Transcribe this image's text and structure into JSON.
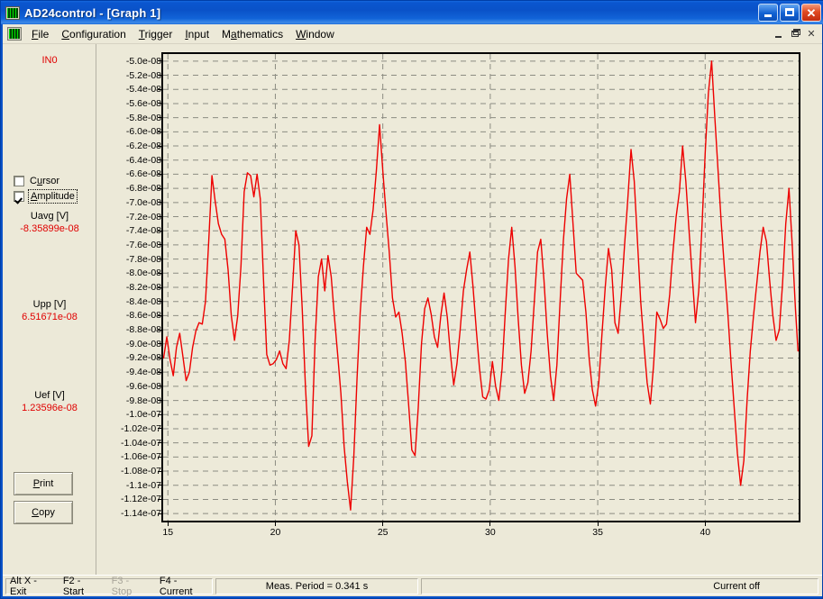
{
  "window": {
    "title": "AD24control - [Graph 1]",
    "icon": "oscilloscope-icon",
    "buttons": {
      "minimize": "_",
      "maximize": "□",
      "close": "✕"
    }
  },
  "menu": {
    "icon": "oscilloscope-icon",
    "items": [
      {
        "label": "File",
        "accel": "F"
      },
      {
        "label": "Configuration",
        "accel": "C"
      },
      {
        "label": "Trigger",
        "accel": "T"
      },
      {
        "label": "Input",
        "accel": "I"
      },
      {
        "label": "Mathematics",
        "accel": "a"
      },
      {
        "label": "Window",
        "accel": "W"
      }
    ],
    "mdi_buttons": {
      "minimize": "_",
      "restore": "❐",
      "close": "✕"
    }
  },
  "side_panel": {
    "channel": "IN0",
    "checkboxes": [
      {
        "name": "cursor",
        "label": "Cursor",
        "checked": false,
        "focused": false
      },
      {
        "name": "amplitude",
        "label": "Amplitude",
        "checked": true,
        "focused": true
      }
    ],
    "measurements": [
      {
        "name": "Uavg [V]",
        "value": "-8.35899e-08"
      },
      {
        "name": "Upp [V]",
        "value": "6.51671e-08"
      },
      {
        "name": "Uef [V]",
        "value": "1.23596e-08"
      }
    ],
    "buttons": [
      {
        "name": "print",
        "label": "Print"
      },
      {
        "name": "copy",
        "label": "Copy"
      }
    ]
  },
  "status_bar": {
    "keys": [
      {
        "label": "Alt X - Exit",
        "enabled": true
      },
      {
        "label": "F2 - Start",
        "enabled": true
      },
      {
        "label": "F3 - Stop",
        "enabled": false
      },
      {
        "label": "F4 - Current",
        "enabled": true
      }
    ],
    "period": "Meas. Period = 0.341 s",
    "current": "Current off"
  },
  "colors": {
    "trace": "#ee0000",
    "plot_background": "#edead9",
    "grid": "#8c8c82",
    "panel": "#ece9d8",
    "accent_text": "#e00000",
    "titlebar": "#0a52c8"
  },
  "chart_data": {
    "type": "line",
    "title": "Graph 1",
    "xlabel": "",
    "ylabel": "",
    "xlim": [
      14.78,
      44.35
    ],
    "ylim": [
      -1.15e-07,
      -4.9e-08
    ],
    "grid": true,
    "legend": false,
    "series_name": "IN0",
    "xticks": [
      15,
      20,
      25,
      30,
      35,
      40
    ],
    "yticks": [
      "-5.0e-08",
      "-5.2e-08",
      "-5.4e-08",
      "-5.6e-08",
      "-5.8e-08",
      "-6.0e-08",
      "-6.2e-08",
      "-6.4e-08",
      "-6.6e-08",
      "-6.8e-08",
      "-7.0e-08",
      "-7.2e-08",
      "-7.4e-08",
      "-7.6e-08",
      "-7.8e-08",
      "-8.0e-08",
      "-8.2e-08",
      "-8.4e-08",
      "-8.6e-08",
      "-8.8e-08",
      "-9.0e-08",
      "-9.2e-08",
      "-9.4e-08",
      "-9.6e-08",
      "-9.8e-08",
      "-1.0e-07",
      "-1.02e-07",
      "-1.04e-07",
      "-1.06e-07",
      "-1.08e-07",
      "-1.1e-07",
      "-1.12e-07",
      "-1.14e-07"
    ],
    "ytick_values": [
      -5e-08,
      -5.2e-08,
      -5.4e-08,
      -5.6e-08,
      -5.8e-08,
      -6e-08,
      -6.2e-08,
      -6.4e-08,
      -6.6e-08,
      -6.8e-08,
      -7e-08,
      -7.2e-08,
      -7.4e-08,
      -7.6e-08,
      -7.8e-08,
      -8e-08,
      -8.2e-08,
      -8.4e-08,
      -8.6e-08,
      -8.8e-08,
      -9e-08,
      -9.2e-08,
      -9.4e-08,
      -9.6e-08,
      -9.8e-08,
      -1e-07,
      -1.02e-07,
      -1.04e-07,
      -1.06e-07,
      -1.08e-07,
      -1.1e-07,
      -1.12e-07,
      -1.14e-07
    ],
    "x": [
      14.8,
      14.95,
      15.1,
      15.25,
      15.4,
      15.55,
      15.7,
      15.85,
      16.0,
      16.15,
      16.3,
      16.45,
      16.6,
      16.75,
      16.9,
      17.05,
      17.2,
      17.35,
      17.5,
      17.65,
      17.8,
      17.95,
      18.1,
      18.25,
      18.4,
      18.55,
      18.7,
      18.85,
      19.0,
      19.15,
      19.3,
      19.45,
      19.6,
      19.75,
      19.9,
      20.05,
      20.2,
      20.35,
      20.5,
      20.65,
      20.8,
      20.95,
      21.1,
      21.25,
      21.4,
      21.55,
      21.7,
      21.85,
      22.0,
      22.15,
      22.3,
      22.45,
      22.6,
      22.75,
      22.9,
      23.05,
      23.2,
      23.35,
      23.5,
      23.65,
      23.8,
      23.95,
      24.1,
      24.25,
      24.4,
      24.55,
      24.7,
      24.85,
      25.0,
      25.15,
      25.3,
      25.45,
      25.6,
      25.75,
      25.9,
      26.05,
      26.2,
      26.35,
      26.5,
      26.65,
      26.8,
      26.95,
      27.1,
      27.25,
      27.4,
      27.55,
      27.7,
      27.85,
      28.0,
      28.15,
      28.3,
      28.45,
      28.6,
      28.75,
      28.9,
      29.05,
      29.2,
      29.35,
      29.5,
      29.65,
      29.8,
      29.95,
      30.1,
      30.25,
      30.4,
      30.55,
      30.7,
      30.85,
      31.0,
      31.15,
      31.3,
      31.45,
      31.6,
      31.75,
      31.9,
      32.05,
      32.2,
      32.35,
      32.5,
      32.65,
      32.8,
      32.95,
      33.1,
      33.25,
      33.4,
      33.55,
      33.7,
      33.85,
      34.0,
      34.15,
      34.3,
      34.45,
      34.6,
      34.75,
      34.9,
      35.05,
      35.2,
      35.35,
      35.5,
      35.65,
      35.8,
      35.95,
      36.1,
      36.25,
      36.4,
      36.55,
      36.7,
      36.85,
      37.0,
      37.15,
      37.3,
      37.45,
      37.6,
      37.75,
      37.9,
      38.05,
      38.2,
      38.35,
      38.5,
      38.65,
      38.8,
      38.95,
      39.1,
      39.25,
      39.4,
      39.55,
      39.7,
      39.85,
      40.0,
      40.15,
      40.3,
      40.45,
      40.6,
      40.75,
      40.9,
      41.05,
      41.2,
      41.35,
      41.5,
      41.65,
      41.8,
      41.95,
      42.1,
      42.25,
      42.4,
      42.55,
      42.7,
      42.85,
      43.0,
      43.15,
      43.3,
      43.45,
      43.6,
      43.75,
      43.9,
      44.05,
      44.2,
      44.32
    ],
    "y": [
      -9.2e-08,
      -8.9e-08,
      -9.22e-08,
      -9.45e-08,
      -9.05e-08,
      -8.85e-08,
      -9.18e-08,
      -9.52e-08,
      -9.4e-08,
      -9.05e-08,
      -8.82e-08,
      -8.7e-08,
      -8.72e-08,
      -8.4e-08,
      -7.55e-08,
      -6.62e-08,
      -6.98e-08,
      -7.3e-08,
      -7.45e-08,
      -7.52e-08,
      -7.95e-08,
      -8.6e-08,
      -8.95e-08,
      -8.6e-08,
      -7.9e-08,
      -6.85e-08,
      -6.58e-08,
      -6.62e-08,
      -6.92e-08,
      -6.6e-08,
      -6.95e-08,
      -8.1e-08,
      -9.15e-08,
      -9.3e-08,
      -9.28e-08,
      -9.22e-08,
      -9.1e-08,
      -9.28e-08,
      -9.35e-08,
      -8.95e-08,
      -8.2e-08,
      -7.4e-08,
      -7.6e-08,
      -8.5e-08,
      -9.6e-08,
      -1.045e-07,
      -1.03e-07,
      -8.95e-08,
      -8.05e-08,
      -7.8e-08,
      -8.25e-08,
      -7.75e-08,
      -8.05e-08,
      -8.62e-08,
      -9.15e-08,
      -9.7e-08,
      -1.045e-07,
      -1.095e-07,
      -1.135e-07,
      -1.06e-07,
      -9.5e-08,
      -8.55e-08,
      -7.9e-08,
      -7.35e-08,
      -7.45e-08,
      -7.1e-08,
      -6.55e-08,
      -5.9e-08,
      -6.55e-08,
      -7.15e-08,
      -7.7e-08,
      -8.35e-08,
      -8.62e-08,
      -8.55e-08,
      -8.85e-08,
      -9.25e-08,
      -9.85e-08,
      -1.05e-07,
      -1.058e-07,
      -9.9e-08,
      -9e-08,
      -8.5e-08,
      -8.35e-08,
      -8.58e-08,
      -8.9e-08,
      -9.05e-08,
      -8.6e-08,
      -8.28e-08,
      -8.62e-08,
      -9.15e-08,
      -9.58e-08,
      -9.28e-08,
      -8.8e-08,
      -8.25e-08,
      -7.95e-08,
      -7.7e-08,
      -8.2e-08,
      -8.8e-08,
      -9.35e-08,
      -9.75e-08,
      -9.78e-08,
      -9.65e-08,
      -9.25e-08,
      -9.6e-08,
      -9.8e-08,
      -9.35e-08,
      -8.55e-08,
      -7.8e-08,
      -7.35e-08,
      -7.9e-08,
      -8.65e-08,
      -9.3e-08,
      -9.7e-08,
      -9.55e-08,
      -9.1e-08,
      -8.4e-08,
      -7.7e-08,
      -7.52e-08,
      -8.1e-08,
      -8.85e-08,
      -9.45e-08,
      -9.8e-08,
      -9.3e-08,
      -8.4e-08,
      -7.55e-08,
      -6.95e-08,
      -6.6e-08,
      -7.3e-08,
      -8e-08,
      -8.05e-08,
      -8.1e-08,
      -8.55e-08,
      -9.2e-08,
      -9.65e-08,
      -9.88e-08,
      -9.55e-08,
      -8.85e-08,
      -8.2e-08,
      -7.65e-08,
      -7.95e-08,
      -8.7e-08,
      -8.85e-08,
      -8.3e-08,
      -7.6e-08,
      -6.95e-08,
      -6.25e-08,
      -6.7e-08,
      -7.55e-08,
      -8.4e-08,
      -9e-08,
      -9.55e-08,
      -9.85e-08,
      -9.3e-08,
      -8.55e-08,
      -8.65e-08,
      -8.78e-08,
      -8.72e-08,
      -8.3e-08,
      -7.7e-08,
      -7.2e-08,
      -6.85e-08,
      -6.2e-08,
      -6.7e-08,
      -7.4e-08,
      -8.05e-08,
      -8.7e-08,
      -8.25e-08,
      -7.35e-08,
      -6.3e-08,
      -5.45e-08,
      -5e-08,
      -5.8e-08,
      -6.55e-08,
      -7.3e-08,
      -7.95e-08,
      -8.55e-08,
      -9.25e-08,
      -9.9e-08,
      -1.055e-07,
      -1.1e-07,
      -1.065e-07,
      -9.8e-08,
      -9.1e-08,
      -8.6e-08,
      -8.15e-08,
      -7.7e-08,
      -7.35e-08,
      -7.55e-08,
      -8.1e-08,
      -8.6e-08,
      -8.95e-08,
      -8.8e-08,
      -8.15e-08,
      -7.3e-08,
      -6.8e-08,
      -7.6e-08,
      -8.5e-08,
      -9.1e-08
    ]
  }
}
